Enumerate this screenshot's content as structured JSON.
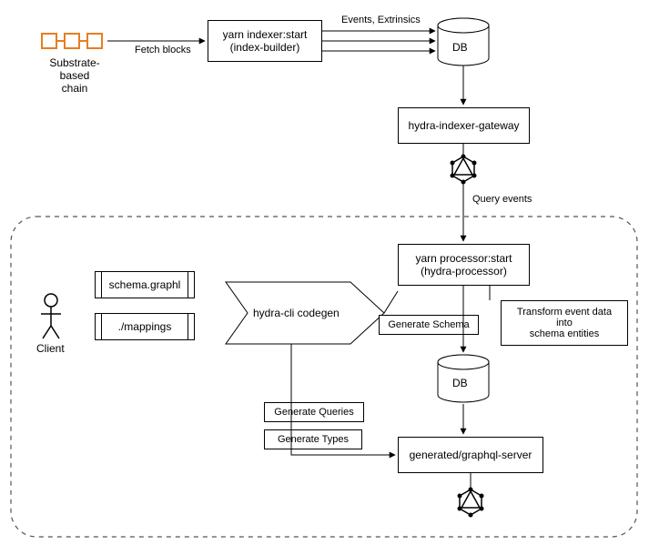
{
  "nodes": {
    "substrate_chain": "Substrate-\nbased\nchain",
    "fetch_blocks": "Fetch blocks",
    "indexer": "yarn indexer:start\n(index-builder)",
    "events_ext": "Events, Extrinsics",
    "db1": "DB",
    "gateway": "hydra-indexer-gateway",
    "query_events": "Query events",
    "processor": "yarn processor:start\n(hydra-processor)",
    "transform": "Transform event data\ninto\nschema entities",
    "client": "Client",
    "schema_file": "schema.graphl",
    "mappings_file": "./mappings",
    "codegen": "hydra-cli codegen",
    "gen_schema": "Generate Schema",
    "gen_queries": "Generate Queries",
    "gen_types": "Generate Types",
    "db2": "DB",
    "gql_server": "generated/graphql-server"
  }
}
